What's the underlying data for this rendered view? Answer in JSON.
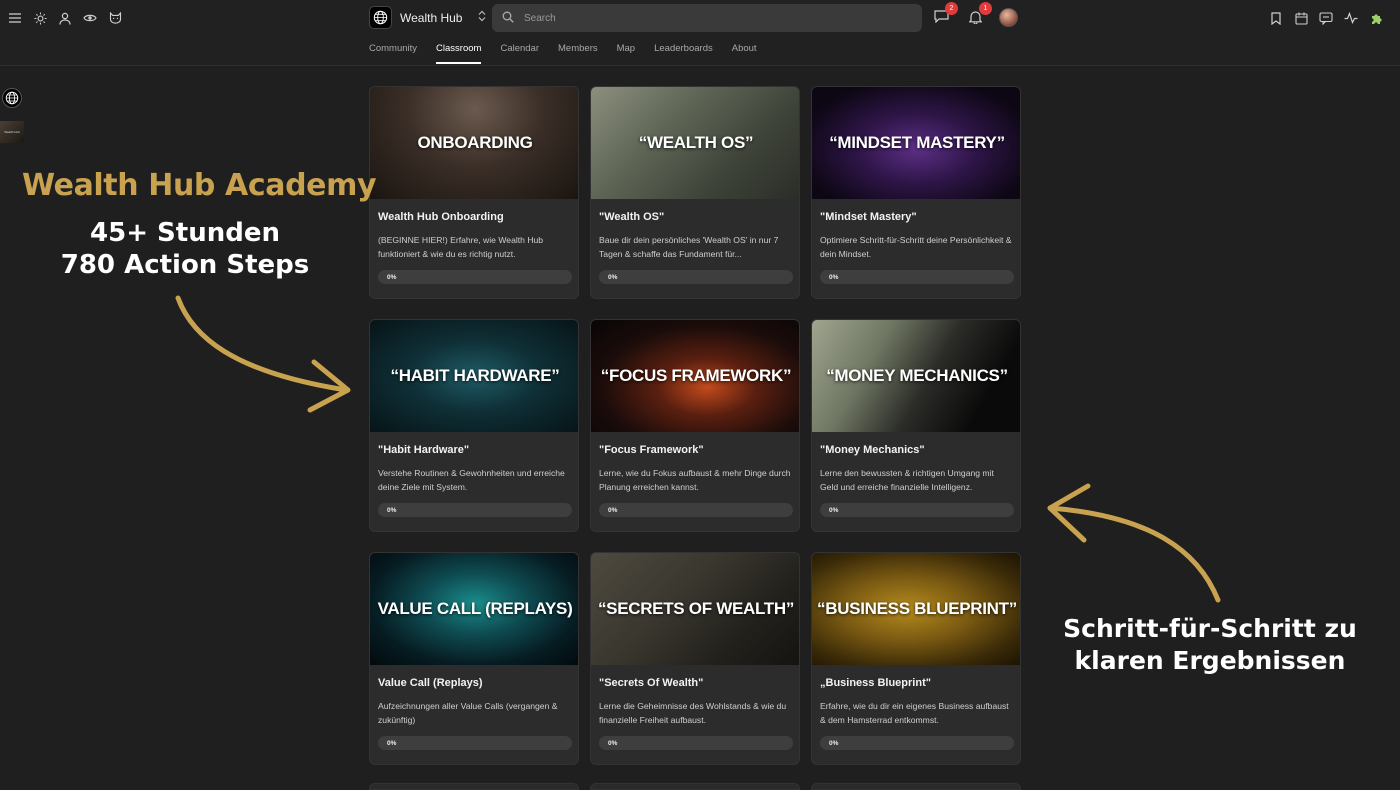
{
  "header": {
    "brand_name": "Wealth Hub",
    "search_placeholder": "Search",
    "chat_badge": "2",
    "bell_badge": "1"
  },
  "tabs": [
    "Community",
    "Classroom",
    "Calendar",
    "Members",
    "Map",
    "Leaderboards",
    "About"
  ],
  "active_tab": "Classroom",
  "sidebar": {
    "thumb_label": "Wealth Hub"
  },
  "courses": [
    {
      "image_title": "ONBOARDING",
      "title": "Wealth Hub Onboarding",
      "description": "(BEGINNE HIER!) Erfahre, wie Wealth Hub funktioniert & wie du es richtig nutzt.",
      "progress": "0%"
    },
    {
      "image_title": "“WEALTH OS”",
      "title": "\"Wealth OS\"",
      "description": "Baue dir dein persönliches 'Wealth OS' in nur 7 Tagen & schaffe das Fundament für...",
      "progress": "0%"
    },
    {
      "image_title": "“MINDSET MASTERY”",
      "title": "\"Mindset Mastery\"",
      "description": "Optimiere Schritt-für-Schritt deine Persönlichkeit & dein Mindset.",
      "progress": "0%"
    },
    {
      "image_title": "“HABIT HARDWARE”",
      "title": "\"Habit Hardware\"",
      "description": "Verstehe Routinen & Gewohnheiten und erreiche deine Ziele mit System.",
      "progress": "0%"
    },
    {
      "image_title": "“FOCUS FRAMEWORK”",
      "title": "\"Focus Framework\"",
      "description": "Lerne, wie du Fokus aufbaust & mehr Dinge durch Planung erreichen kannst.",
      "progress": "0%"
    },
    {
      "image_title": "“MONEY MECHANICS”",
      "title": "\"Money Mechanics\"",
      "description": "Lerne den bewussten & richtigen Umgang mit Geld und erreiche finanzielle Intelligenz.",
      "progress": "0%"
    },
    {
      "image_title": "VALUE CALL (REPLAYS)",
      "title": "Value Call (Replays)",
      "description": "Aufzeichnungen aller Value Calls (vergangen & zukünftig)",
      "progress": "0%"
    },
    {
      "image_title": "“SECRETS OF WEALTH”",
      "title": "\"Secrets Of Wealth\"",
      "description": "Lerne die Geheimnisse des Wohlstands & wie du finanzielle Freiheit aufbaust.",
      "progress": "0%"
    },
    {
      "image_title": "“BUSINESS BLUEPRINT”",
      "title": "„Business Blueprint\"",
      "description": "Erfahre, wie du dir ein eigenes Business aufbaust & dem Hamsterrad entkommst.",
      "progress": "0%"
    }
  ],
  "promo": {
    "title": "Wealth Hub Academy",
    "line1": "45+ Stunden",
    "line2": "780 Action Steps",
    "right_line1": "Schritt-für-Schritt zu",
    "right_line2": "klaren Ergebnissen",
    "accent_color": "#c9a24f"
  }
}
